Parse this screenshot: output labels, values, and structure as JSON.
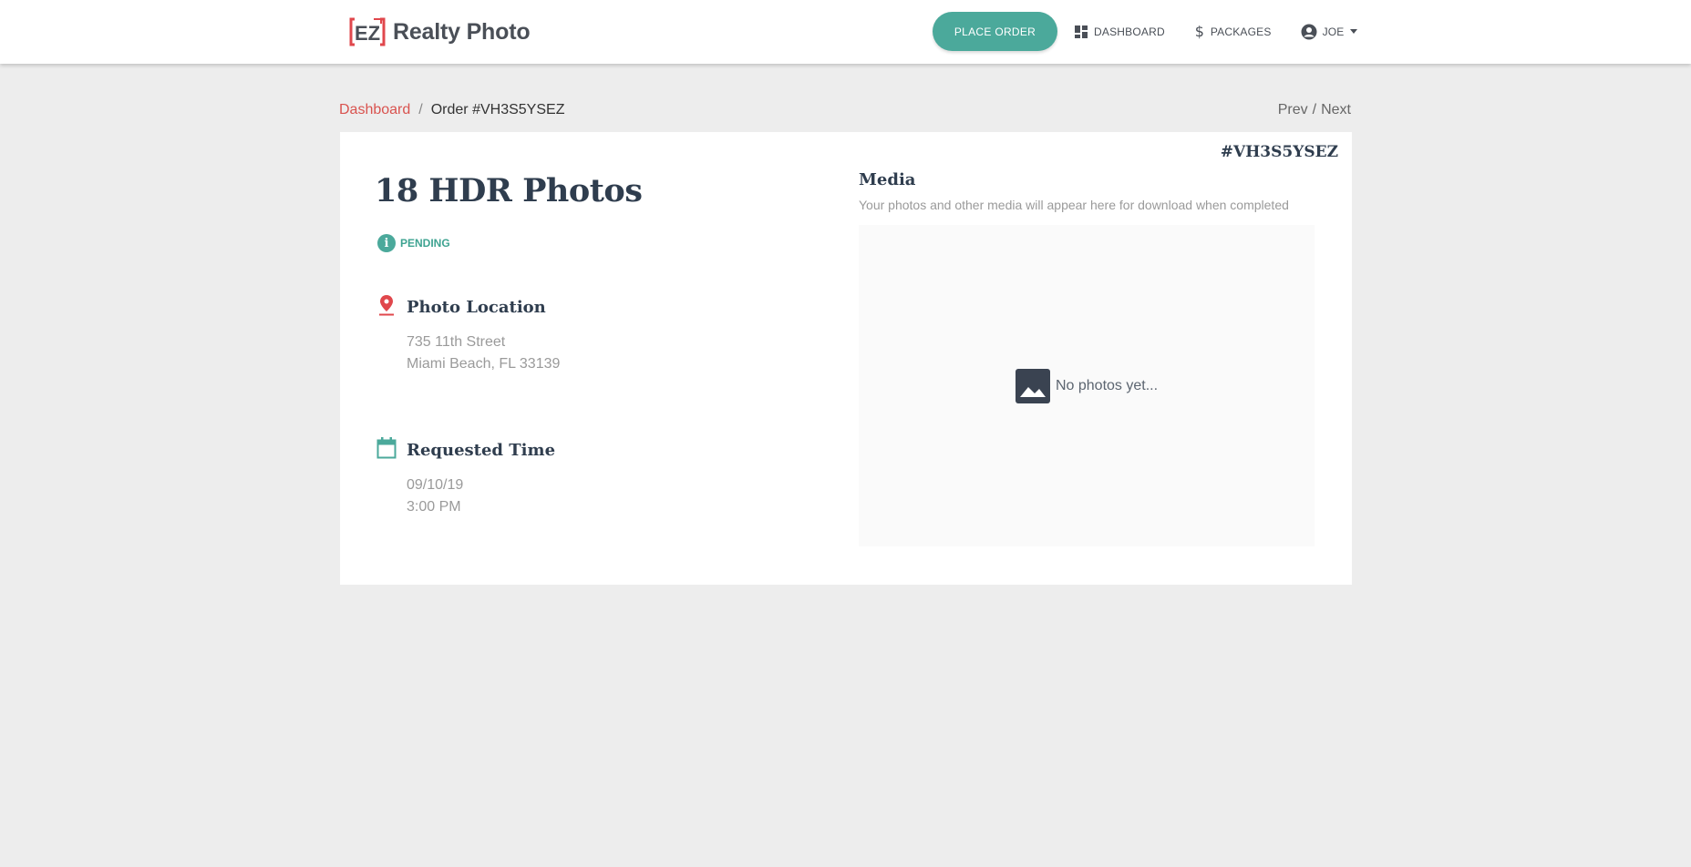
{
  "header": {
    "brand_name": "Realty Photo",
    "logo_text": "EZ",
    "place_order_label": "PLACE ORDER",
    "dashboard_label": "DASHBOARD",
    "packages_label": "PACKAGES",
    "user_label": "JOE"
  },
  "breadcrumb": {
    "home": "Dashboard",
    "separator": "/",
    "current": "Order #VH3S5YSEZ"
  },
  "pager": {
    "prev": "Prev",
    "separator": "/",
    "next": "Next"
  },
  "order": {
    "id": "#VH3S5YSEZ",
    "title": "18 HDR Photos",
    "status": "PENDING",
    "location": {
      "heading": "Photo Location",
      "line1": "735 11th Street",
      "line2": "Miami Beach, FL 33139"
    },
    "time": {
      "heading": "Requested Time",
      "date": "09/10/19",
      "time": "3:00 PM"
    }
  },
  "media": {
    "heading": "Media",
    "subtitle": "Your photos and other media will appear here for download when completed",
    "empty_text": "No photos yet..."
  },
  "colors": {
    "accent": "#4ba99b",
    "link": "#d9534f",
    "heading": "#2f3d4e",
    "background": "#ededed"
  },
  "icons": [
    "ez-logo-icon",
    "dashboard-icon",
    "dollar-icon",
    "account-circle-icon",
    "caret-down-icon",
    "info-icon",
    "map-pin-icon",
    "calendar-icon",
    "image-icon"
  ]
}
